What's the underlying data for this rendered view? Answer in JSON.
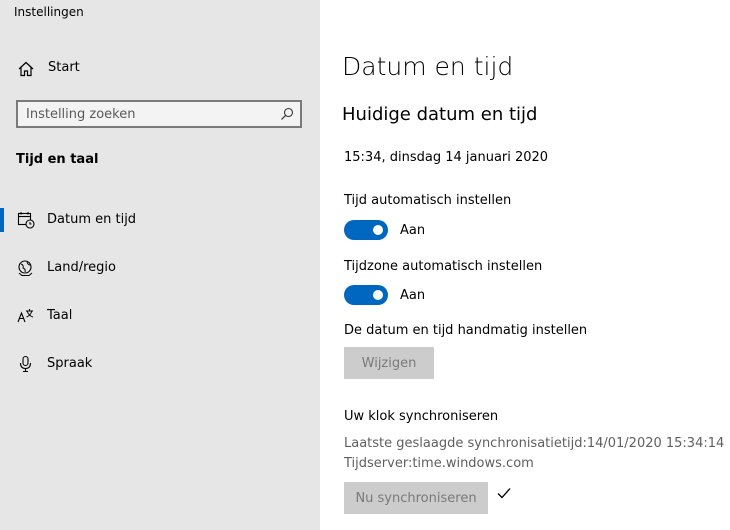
{
  "app": {
    "title": "Instellingen"
  },
  "sidebar": {
    "home_label": "Start",
    "search_placeholder": "Instelling zoeken",
    "section_title": "Tijd en taal",
    "items": [
      {
        "label": "Datum en tijd",
        "icon": "calendar-clock-icon",
        "selected": true
      },
      {
        "label": "Land/regio",
        "icon": "globe-icon",
        "selected": false
      },
      {
        "label": "Taal",
        "icon": "language-icon",
        "selected": false
      },
      {
        "label": "Spraak",
        "icon": "microphone-icon",
        "selected": false
      }
    ]
  },
  "main": {
    "title": "Datum en tijd",
    "subtitle": "Huidige datum en tijd",
    "current_datetime": "15:34, dinsdag 14 januari 2020",
    "auto_time": {
      "label": "Tijd automatisch instellen",
      "state": "Aan",
      "on": true
    },
    "auto_timezone": {
      "label": "Tijdzone automatisch instellen",
      "state": "Aan",
      "on": true
    },
    "manual": {
      "label": "De datum en tijd handmatig instellen",
      "button": "Wijzigen"
    },
    "sync": {
      "heading": "Uw klok synchroniseren",
      "last_sync": "Laatste geslaagde synchronisatietijd:14/01/2020 15:34:14",
      "server": "Tijdserver:time.windows.com",
      "button": "Nu synchroniseren",
      "status_icon": "checkmark-icon"
    }
  },
  "colors": {
    "accent": "#0067c0",
    "sidebar_bg": "#e6e6e6",
    "disabled_button": "#cccccc"
  }
}
